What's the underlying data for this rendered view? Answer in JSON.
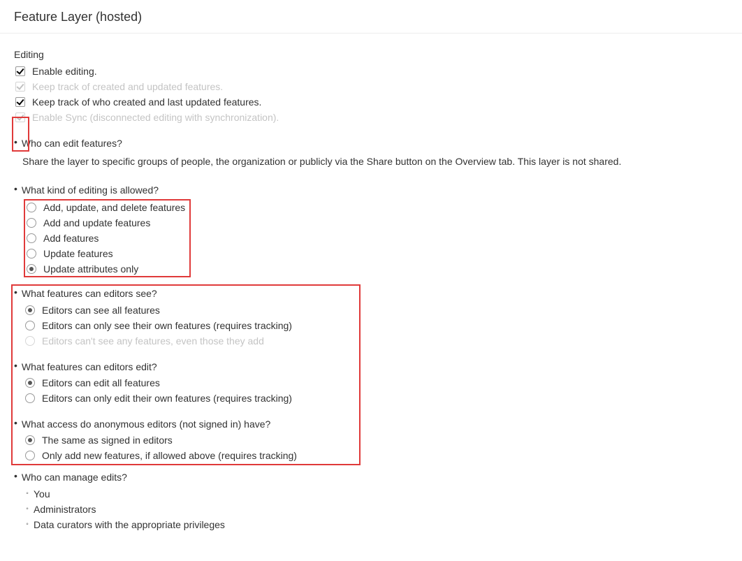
{
  "header": {
    "title": "Feature Layer (hosted)"
  },
  "editing": {
    "title": "Editing",
    "enable_editing": "Enable editing.",
    "keep_track_created": "Keep track of created and updated features.",
    "keep_track_who": "Keep track of who created and last updated features.",
    "enable_sync": "Enable Sync (disconnected editing with synchronization)."
  },
  "who_edit": {
    "heading": "Who can edit features?",
    "body": "Share the layer to specific groups of people, the organization or publicly via the Share button on the Overview tab. This layer is not shared."
  },
  "kind_editing": {
    "heading": "What kind of editing is allowed?",
    "options": {
      "0": "Add, update, and delete features",
      "1": "Add and update features",
      "2": "Add features",
      "3": "Update features",
      "4": "Update attributes only"
    }
  },
  "editors_see": {
    "heading": "What features can editors see?",
    "options": {
      "0": "Editors can see all features",
      "1": "Editors can only see their own features (requires tracking)",
      "2": "Editors can't see any features, even those they add"
    }
  },
  "editors_edit": {
    "heading": "What features can editors edit?",
    "options": {
      "0": "Editors can edit all features",
      "1": "Editors can only edit their own features (requires tracking)"
    }
  },
  "anon_access": {
    "heading": "What access do anonymous editors (not signed in) have?",
    "options": {
      "0": "The same as signed in editors",
      "1": "Only add new features, if allowed above (requires tracking)"
    }
  },
  "manage": {
    "heading": "Who can manage edits?",
    "items": {
      "0": "You",
      "1": "Administrators",
      "2": "Data curators with the appropriate privileges"
    }
  }
}
